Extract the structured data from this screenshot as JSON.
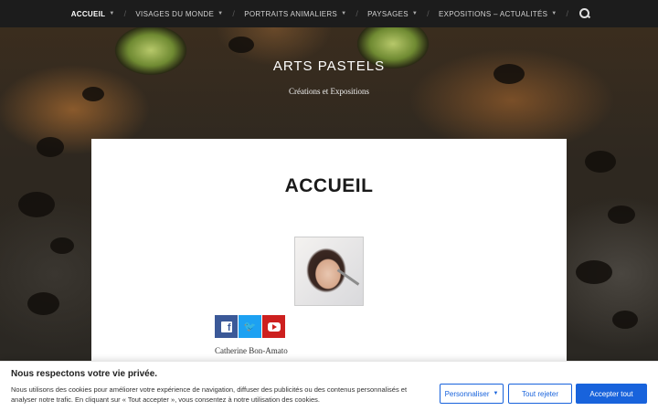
{
  "nav": {
    "items": [
      {
        "label": "ACCUEIL",
        "active": true,
        "has_dropdown": true
      },
      {
        "label": "VISAGES DU MONDE",
        "active": false,
        "has_dropdown": true
      },
      {
        "label": "PORTRAITS ANIMALIERS",
        "active": false,
        "has_dropdown": true
      },
      {
        "label": "PAYSAGES",
        "active": false,
        "has_dropdown": true
      },
      {
        "label": "EXPOSITIONS – ACTUALITÉS",
        "active": false,
        "has_dropdown": true
      }
    ],
    "search_icon": "search-icon"
  },
  "header": {
    "site_title": "ARTS PASTELS",
    "site_description": "Créations et Expositions"
  },
  "main": {
    "page_title": "ACCUEIL",
    "portrait_icon": "profile-photo",
    "social": [
      {
        "name": "facebook",
        "icon": "facebook-icon",
        "color": "#3b5998"
      },
      {
        "name": "twitter",
        "icon": "twitter-icon",
        "color": "#1da1f2"
      },
      {
        "name": "youtube",
        "icon": "youtube-icon",
        "color": "#cd201f"
      }
    ],
    "author": "Catherine Bon-Amato"
  },
  "cookie": {
    "title": "Nous respectons votre vie privée.",
    "text": "Nous utilisons des cookies pour améliorer votre expérience de navigation, diffuser des publicités ou des contenus personnalisés et analyser notre trafic. En cliquant sur « Tout accepter », vous consentez à notre utilisation des cookies.",
    "customize_label": "Personnaliser",
    "reject_label": "Tout rejeter",
    "accept_label": "Accepter tout",
    "accent_color": "#1863dc"
  }
}
